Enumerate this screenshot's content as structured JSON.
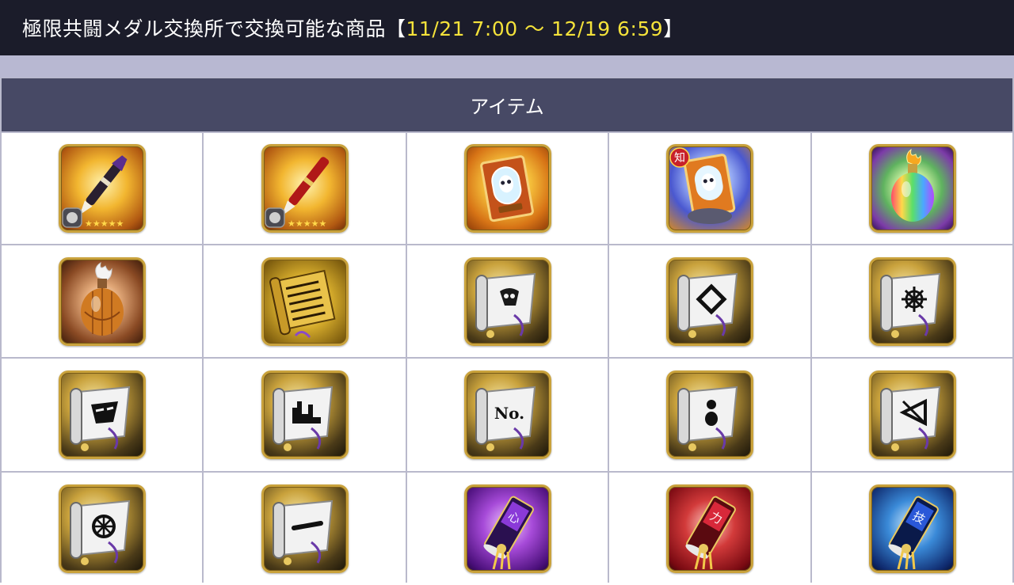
{
  "header": {
    "title": "極限共闘メダル交換所で交換可能な商品",
    "period_open": "【",
    "period": "11/21 7:00 〜 12/19 6:59",
    "period_close": "】"
  },
  "table": {
    "column_header": "アイテム"
  },
  "items": [
    {
      "icon": "brush-weapon-purple-icon",
      "stars": "★★★★★"
    },
    {
      "icon": "brush-weapon-red-icon",
      "stars": "★★★★★"
    },
    {
      "icon": "hollow-mask-card-icon"
    },
    {
      "icon": "hollow-mask-card-blue-icon",
      "badge": "知"
    },
    {
      "icon": "rainbow-potion-icon"
    },
    {
      "icon": "copper-potion-icon"
    },
    {
      "icon": "golden-scroll-icon"
    },
    {
      "icon": "scroll-hollow-mark-icon"
    },
    {
      "icon": "scroll-diamond-mark-icon"
    },
    {
      "icon": "scroll-flower-mark-icon"
    },
    {
      "icon": "scroll-mask-mark-icon"
    },
    {
      "icon": "scroll-city-mark-icon"
    },
    {
      "icon": "scroll-no-mark-icon",
      "mark": "No."
    },
    {
      "icon": "scroll-dots-mark-icon"
    },
    {
      "icon": "scroll-bow-mark-icon"
    },
    {
      "icon": "scroll-wheel-mark-icon"
    },
    {
      "icon": "scroll-line-mark-icon"
    },
    {
      "icon": "purple-talisman-icon",
      "mark": "心"
    },
    {
      "icon": "red-talisman-icon",
      "mark": "力"
    },
    {
      "icon": "blue-talisman-icon",
      "mark": "技"
    }
  ],
  "colors": {
    "title_bg": "#1b1c2a",
    "period_text": "#f4e23a",
    "header_bg": "#474965",
    "grid_line": "#b9b9cc"
  }
}
